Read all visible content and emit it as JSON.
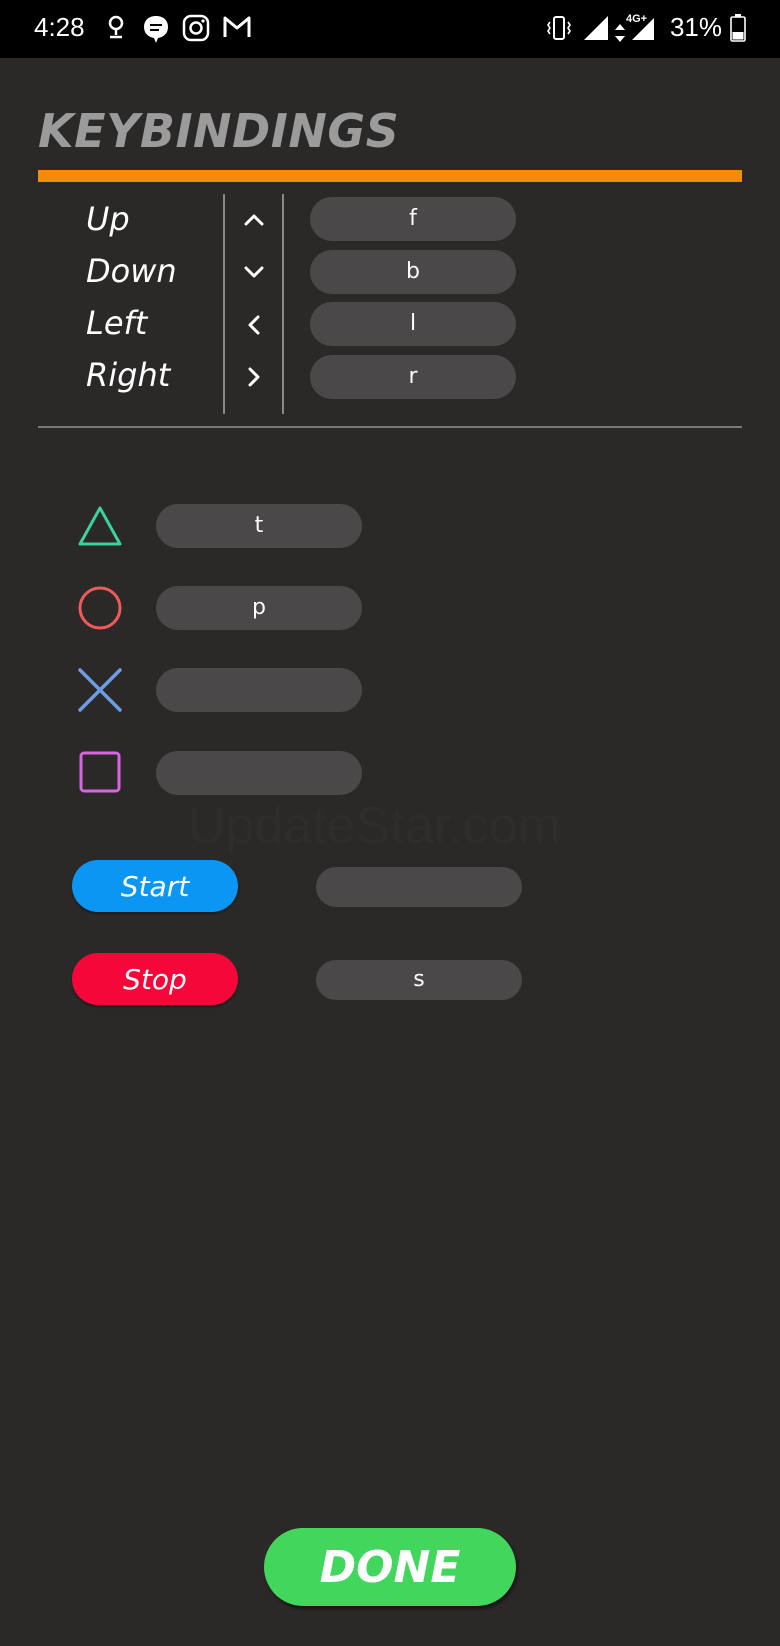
{
  "status_bar": {
    "time": "4:28",
    "battery": "31%",
    "network": "4G+"
  },
  "title": "KEYBINDINGS",
  "directions": [
    {
      "label": "Up",
      "key": "f"
    },
    {
      "label": "Down",
      "key": "b"
    },
    {
      "label": "Left",
      "key": "l"
    },
    {
      "label": "Right",
      "key": "r"
    }
  ],
  "face_buttons": [
    {
      "shape": "triangle-icon",
      "key": "t",
      "color": "#3ed19a"
    },
    {
      "shape": "circle-icon",
      "key": "p",
      "color": "#ee5b5b"
    },
    {
      "shape": "cross-icon",
      "key": "",
      "color": "#6a9ee6"
    },
    {
      "shape": "square-icon",
      "key": "",
      "color": "#d864e0"
    }
  ],
  "controls": {
    "start_label": "Start",
    "start_key": "",
    "stop_label": "Stop",
    "stop_key": "s"
  },
  "done_label": "DONE",
  "watermark": "UpdateStar.com",
  "colors": {
    "accent": "#f68b0a",
    "start": "#0a96f2",
    "stop": "#f5073a",
    "done": "#42d65d",
    "background": "#2b2828",
    "pill": "#4a4848"
  }
}
